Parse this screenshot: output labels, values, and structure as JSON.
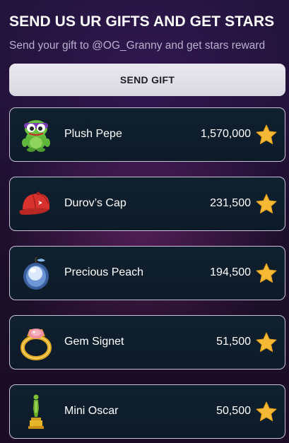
{
  "header": {
    "title": "SEND US UR GIFTS AND GET STARS",
    "subtitle": "Send your gift to @OG_Granny and get stars reward"
  },
  "send_button": {
    "label": "SEND GIFT"
  },
  "gifts": [
    {
      "name": "Plush Pepe",
      "price": "1,570,000",
      "icon": "plush-pepe-icon"
    },
    {
      "name": "Durov’s Cap",
      "price": "231,500",
      "icon": "durovs-cap-icon"
    },
    {
      "name": "Precious Peach",
      "price": "194,500",
      "icon": "precious-peach-icon"
    },
    {
      "name": "Gem Signet",
      "price": "51,500",
      "icon": "gem-signet-icon"
    },
    {
      "name": "Mini Oscar",
      "price": "50,500",
      "icon": "mini-oscar-icon"
    }
  ],
  "colors": {
    "background": "#1a0e2a",
    "row_background": "#0f1e2d",
    "row_border": "#c8c2d8",
    "button_background": "#e3e2ea",
    "star": "#f5b935"
  }
}
